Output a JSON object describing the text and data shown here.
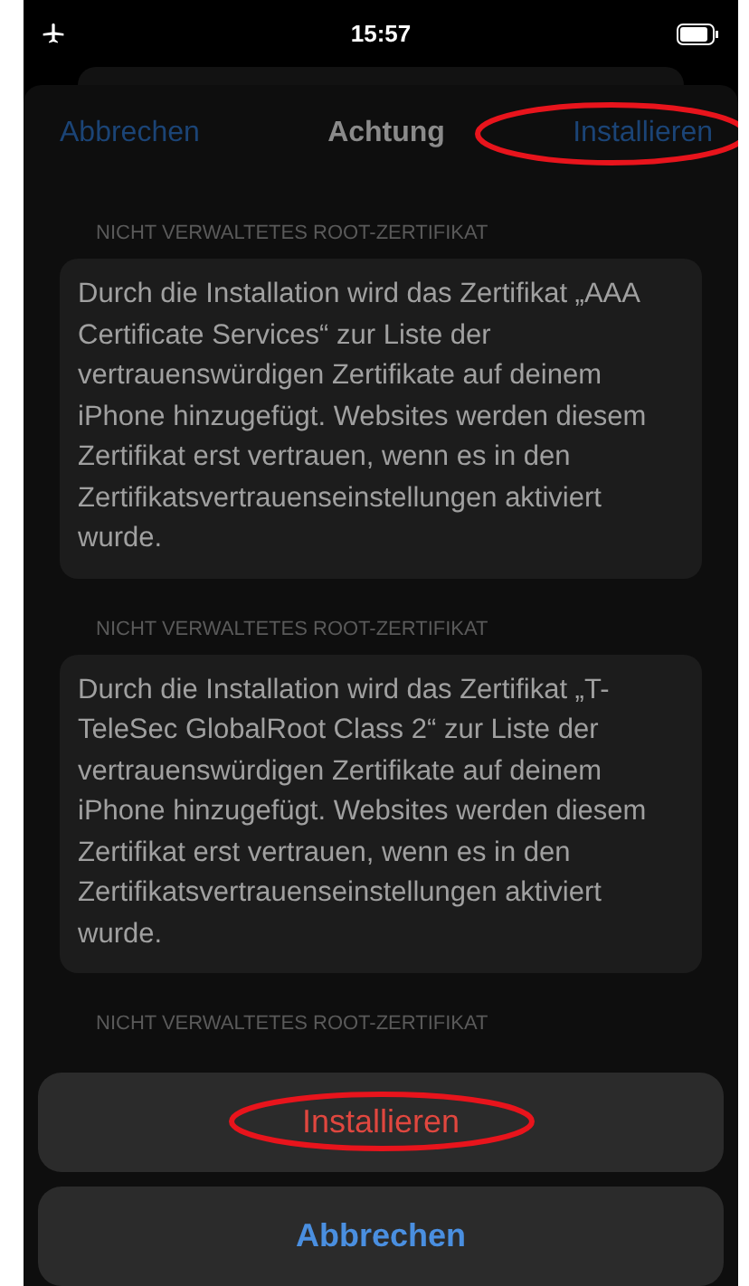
{
  "status_bar": {
    "time": "15:57"
  },
  "nav": {
    "cancel": "Abbrechen",
    "title": "Achtung",
    "install": {
      "label": "Installieren",
      "circled": true
    }
  },
  "sections": [
    {
      "header": "NICHT VERWALTETES ROOT-ZERTIFIKAT",
      "text": "Durch die Installation wird das Zertifikat „AAA Certificate Services“ zur Liste der vertrauenswürdigen Zertifikate auf deinem iPhone hinzugefügt. Websites werden diesem Zertifikat erst vertrauen, wenn es in den Zertifikatsvertrauenseinstellungen aktiviert wurde."
    },
    {
      "header": "NICHT VERWALTETES ROOT-ZERTIFIKAT",
      "text": "Durch die Installation wird das Zertifikat „T-TeleSec GlobalRoot Class 2“ zur Liste der vertrauenswürdigen Zertifikate auf deinem iPhone hinzugefügt. Websites werden diesem Zertifikat erst vertrauen, wenn es in den Zertifikatsvertrauenseinstellungen aktiviert wurde."
    },
    {
      "header": "NICHT VERWALTETES ROOT-ZERTIFIKAT"
    }
  ],
  "action_sheet": [
    {
      "label": "Installieren",
      "kind": "destructive",
      "circled": true
    },
    {
      "label": "Abbrechen",
      "kind": "cancel",
      "circled": false
    }
  ]
}
